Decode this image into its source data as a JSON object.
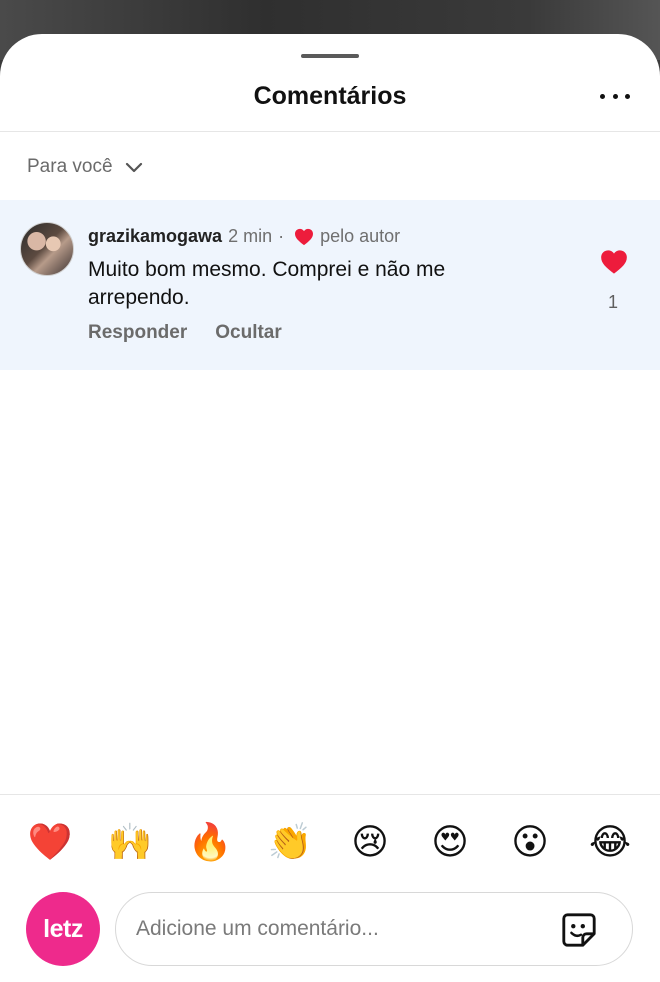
{
  "header": {
    "title": "Comentários"
  },
  "filter": {
    "label": "Para você"
  },
  "comment": {
    "username": "grazikamogawa",
    "time": "2 min",
    "separator": "·",
    "liked_by_author_label": "pelo autor",
    "text": "Muito bom mesmo. Comprei e não me arrependo.",
    "reply_label": "Responder",
    "hide_label": "Ocultar",
    "like_count": "1"
  },
  "reactions": [
    "❤️",
    "🙌",
    "🔥",
    "👏",
    "😢",
    "😍",
    "😮",
    "😂"
  ],
  "composer": {
    "brand_text": "letz",
    "placeholder": "Adicione um comentário..."
  },
  "colors": {
    "heart": "#ed1c3c",
    "brand": "#ee2a8c",
    "comment_highlight": "#eff5fd"
  },
  "icons": {
    "more": "more-horizontal-icon",
    "filter_chevron": "chevron-down-icon",
    "author_like": "heart-filled-icon",
    "like": "heart-filled-icon",
    "sticker": "sticker-icon"
  }
}
